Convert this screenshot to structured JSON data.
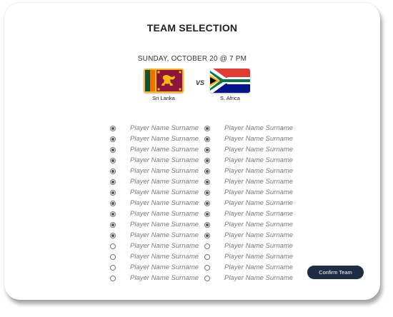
{
  "header": {
    "title": "TEAM SELECTION"
  },
  "match": {
    "date_label": "SUNDAY, OCTOBER 20 @ 7 PM",
    "vs_label": "VS",
    "team1": {
      "name": "Sri Lanka",
      "flag_icon": "sri-lanka-flag"
    },
    "team2": {
      "name": "S. Africa",
      "flag_icon": "south-africa-flag"
    }
  },
  "columns": [
    {
      "players": [
        {
          "name": "Player Name Surname",
          "selected": true
        },
        {
          "name": "Player Name Surname",
          "selected": true
        },
        {
          "name": "Player Name Surname",
          "selected": true
        },
        {
          "name": "Player Name Surname",
          "selected": true
        },
        {
          "name": "Player Name Surname",
          "selected": true
        },
        {
          "name": "Player Name Surname",
          "selected": true
        },
        {
          "name": "Player Name Surname",
          "selected": true
        },
        {
          "name": "Player Name Surname",
          "selected": true
        },
        {
          "name": "Player Name Surname",
          "selected": true
        },
        {
          "name": "Player Name Surname",
          "selected": true
        },
        {
          "name": "Player Name Surname",
          "selected": true
        },
        {
          "name": "Player Name Surname",
          "selected": false
        },
        {
          "name": "Player Name Surname",
          "selected": false
        },
        {
          "name": "Player Name Surname",
          "selected": false
        },
        {
          "name": "Player Name Surname",
          "selected": false
        }
      ]
    },
    {
      "players": [
        {
          "name": "Player Name Surname",
          "selected": true
        },
        {
          "name": "Player Name Surname",
          "selected": true
        },
        {
          "name": "Player Name Surname",
          "selected": true
        },
        {
          "name": "Player Name Surname",
          "selected": true
        },
        {
          "name": "Player Name Surname",
          "selected": true
        },
        {
          "name": "Player Name Surname",
          "selected": true
        },
        {
          "name": "Player Name Surname",
          "selected": true
        },
        {
          "name": "Player Name Surname",
          "selected": true
        },
        {
          "name": "Player Name Surname",
          "selected": true
        },
        {
          "name": "Player Name Surname",
          "selected": true
        },
        {
          "name": "Player Name Surname",
          "selected": true
        },
        {
          "name": "Player Name Surname",
          "selected": false
        },
        {
          "name": "Player Name Surname",
          "selected": false
        },
        {
          "name": "Player Name Surname",
          "selected": false
        },
        {
          "name": "Player Name Surname",
          "selected": false
        }
      ]
    }
  ],
  "actions": {
    "confirm_label": "Confirm Team",
    "confirm_color": "#1e2c44"
  }
}
